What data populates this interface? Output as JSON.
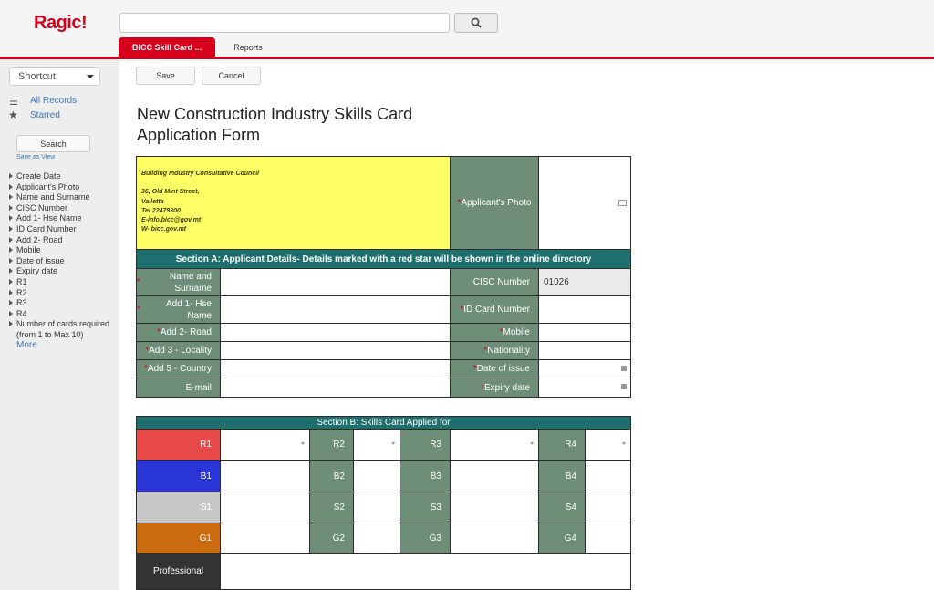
{
  "app": {
    "logo": "Ragic!"
  },
  "tabs": [
    {
      "label": "BICC Skill Card ..."
    },
    {
      "label": "Reports"
    }
  ],
  "sidebar": {
    "shortcut": "Shortcut",
    "all_records": "All Records",
    "starred": "Starred",
    "search": "Search",
    "save_as_view": "Save as View",
    "fields": [
      "Create Date",
      "Applicant's Photo",
      "Name and Surname",
      "CISC Number",
      "Add 1- Hse Name",
      "ID Card Number",
      "Add 2- Road",
      "Mobile",
      "Date of issue",
      "Expiry date",
      "R1",
      "R2",
      "R3",
      "R4",
      "Number of cards required (from 1 to Max 10)"
    ],
    "more": "More"
  },
  "toolbar": {
    "save": "Save",
    "cancel": "Cancel"
  },
  "form": {
    "title": "New Construction Industry Skills Card Application Form",
    "org": {
      "name": "Building Industry Consultative Council",
      "addr1": "36, Old Mint Street,",
      "addr2": "Valletta",
      "tel": "Tel 22479300",
      "email": "E-info.bicc@gov.mt",
      "web": "W- bicc.gov.mt"
    },
    "photo_label": "Applicant's Photo",
    "section_a": "Section A: Applicant Details- Details marked with a red star will be shown in the online directory",
    "left_fields": [
      "Name and Surname",
      "Add 1- Hse Name",
      "Add 2- Road",
      "Add 3 - Locality",
      "Add 5 - Country",
      "E-mail"
    ],
    "right_fields": [
      "CISC Number",
      "ID Card Number",
      "Mobile",
      "Nationality",
      "Date of issue",
      "Expiry date"
    ],
    "cisc_value": "01026",
    "section_b": "Section B: Skills Card Applied for",
    "grid_rows": [
      {
        "labels": [
          "R1",
          "R2",
          "R3",
          "R4"
        ],
        "color": "#e84a4a"
      },
      {
        "labels": [
          "B1",
          "B2",
          "B3",
          "B4"
        ],
        "color": "#2a35d8"
      },
      {
        "labels": [
          "S1",
          "S2",
          "S3",
          "S4"
        ],
        "color": "#c8c8c8"
      },
      {
        "labels": [
          "G1",
          "G2",
          "G3",
          "G4"
        ],
        "color": "#cc6a10"
      }
    ],
    "professional": "Professional",
    "colors": {
      "accent": "#d6001c",
      "label_bg": "#6e8e78",
      "section_bg": "#1f6f6f",
      "org_bg": "#ffff66",
      "professional_bg": "#333333"
    }
  }
}
